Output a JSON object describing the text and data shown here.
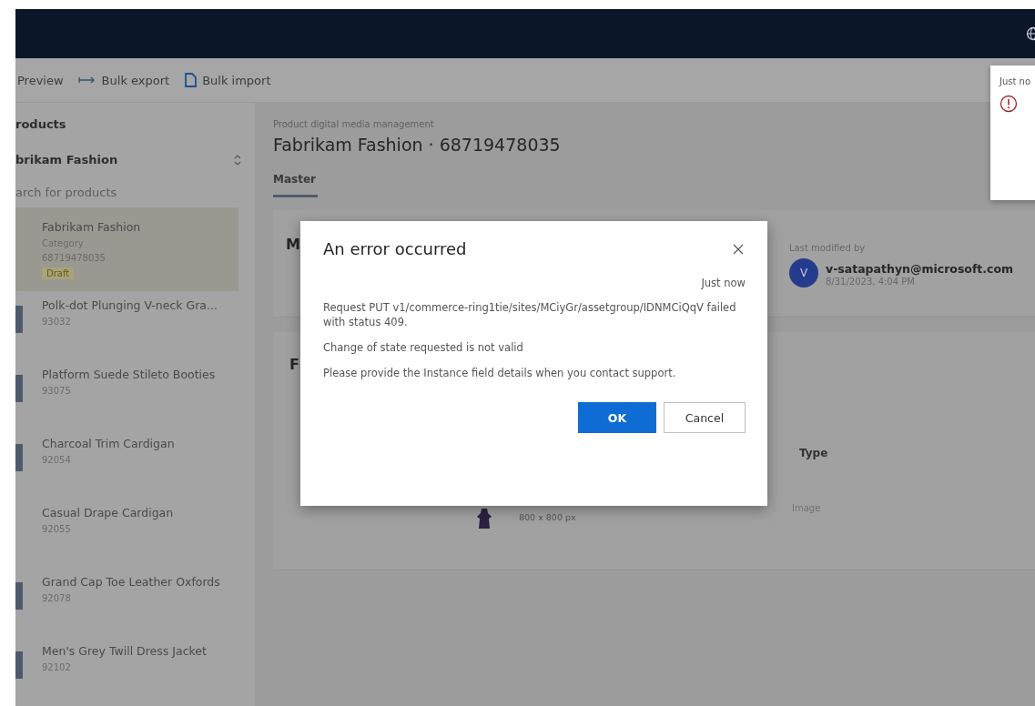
{
  "toolbar": [
    {
      "label": "Preview"
    },
    {
      "label": "Bulk export"
    },
    {
      "label": "Bulk import"
    }
  ],
  "sidebar": {
    "title": "roducts",
    "catalog": "brikam Fashion",
    "search": {
      "placeholder": "arch for products"
    },
    "items": [
      {
        "name": "Fabrikam Fashion",
        "type": "Category",
        "id": "68719478035",
        "status": "Draft",
        "selected": true,
        "thumbnail": false
      },
      {
        "name": "Polk-dot Plunging V-neck Gra...",
        "id": "93032",
        "selected": false,
        "thumbnail": true
      },
      {
        "name": "Platform Suede Stileto Booties",
        "id": "93075",
        "selected": false,
        "thumbnail": true
      },
      {
        "name": "Charcoal Trim Cardigan",
        "id": "92054",
        "selected": false,
        "thumbnail": true
      },
      {
        "name": "Casual Drape Cardigan",
        "id": "92055",
        "selected": false,
        "thumbnail": false
      },
      {
        "name": "Grand Cap Toe Leather Oxfords",
        "id": "92078",
        "selected": false,
        "thumbnail": true
      },
      {
        "name": "Men's Grey Twill Dress Jacket",
        "id": "92102",
        "selected": false,
        "thumbnail": true
      }
    ]
  },
  "main": {
    "breadcrumb": "Product digital media management",
    "title": "Fabrikam Fashion · 68719478035",
    "tabs": [
      {
        "label": "Master",
        "selected": true
      }
    ],
    "details_card": {
      "heading": "M",
      "modified_label": "Last modified by",
      "avatar": "V",
      "user": "v-satapathyn@microsoft.com",
      "date": "8/31/2023, 4:04 PM"
    },
    "media_card": {
      "heading": "F",
      "column": "Type",
      "size": "800 x 800 px",
      "type": "Image"
    }
  },
  "toast": {
    "time": "Just no"
  },
  "dialog": {
    "title": "An error occurred",
    "time": "Just now",
    "messages": [
      "Request PUT v1/commerce-ring1tie/sites/MCiyGr/assetgroup/IDNMCiQqV failed with status 409.",
      "Change of state requested is not valid",
      "Please provide the Instance field details when you contact support."
    ],
    "buttons": [
      {
        "label": "OK",
        "primary": true
      },
      {
        "label": "Cancel",
        "primary": false
      }
    ]
  }
}
